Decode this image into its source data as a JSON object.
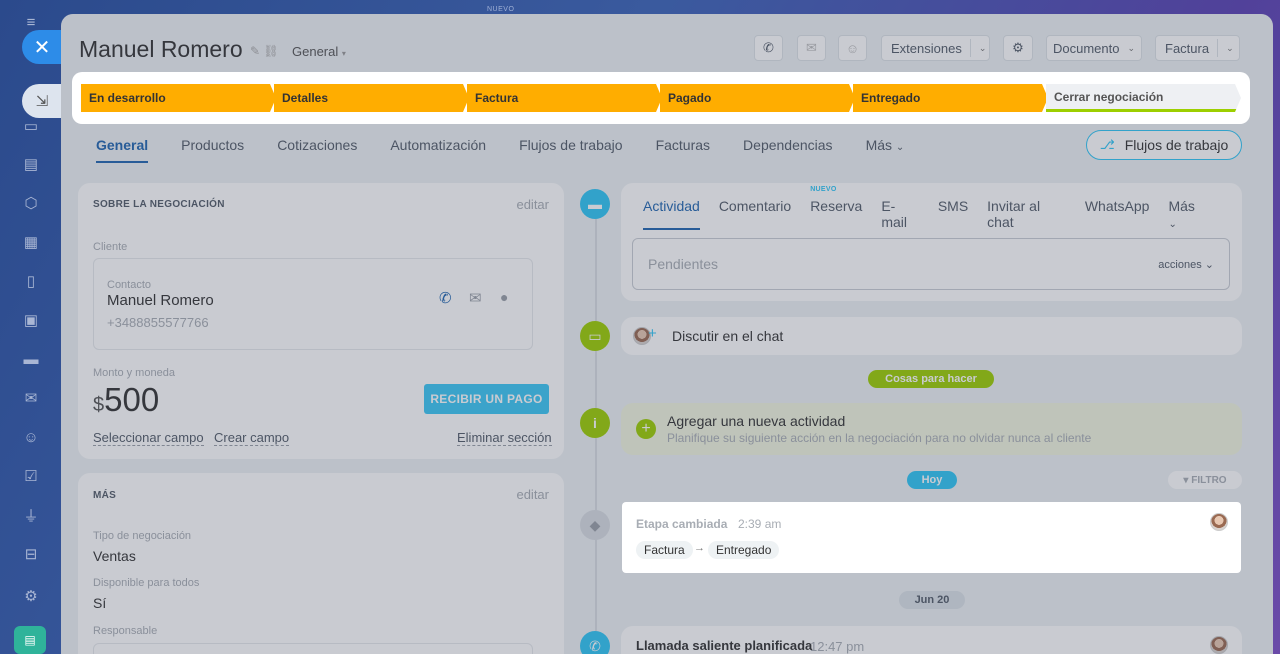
{
  "background": {
    "top_label": "NUEVO"
  },
  "leftbar": {
    "close_icon": "✕",
    "icons": [
      "chat-icon",
      "list-icon",
      "hexagon-icon",
      "calendar-icon",
      "document-icon",
      "board-icon",
      "card-icon",
      "mail-icon",
      "contacts-icon",
      "task-icon",
      "funnel-icon",
      "robot-icon",
      "settings-icon"
    ]
  },
  "header": {
    "title": "Manuel Romero",
    "category": "General",
    "extensions": "Extensiones",
    "document": "Documento",
    "invoice": "Factura"
  },
  "stages": [
    {
      "label": "En desarrollo",
      "color": "#ffad00"
    },
    {
      "label": "Detalles",
      "color": "#ffad00"
    },
    {
      "label": "Factura",
      "color": "#ffad00"
    },
    {
      "label": "Pagado",
      "color": "#ffad00"
    },
    {
      "label": "Entregado",
      "color": "#ffad00"
    },
    {
      "label": "Cerrar negociación",
      "color": "#eef0f3"
    }
  ],
  "tabs": [
    "General",
    "Productos",
    "Cotizaciones",
    "Automatización",
    "Flujos de trabajo",
    "Facturas",
    "Dependencias",
    "Más"
  ],
  "flows_button": "Flujos de trabajo",
  "deal_card": {
    "title": "SOBRE LA NEGOCIACIÓN",
    "edit": "editar",
    "client_label": "Cliente",
    "contact_label": "Contacto",
    "contact_name": "Manuel Romero",
    "contact_phone": "+3488855577766",
    "amount_label": "Monto y moneda",
    "currency": "$",
    "amount": "500",
    "pay_button": "RECIBIR UN PAGO",
    "select_field": "Seleccionar campo",
    "create_field": "Crear campo",
    "delete_section": "Eliminar sección"
  },
  "more_card": {
    "title": "MÁS",
    "edit": "editar",
    "type_label": "Tipo de negociación",
    "type_value": "Ventas",
    "available_label": "Disponible para todos",
    "available_value": "Sí",
    "responsible_label": "Responsable"
  },
  "activity": {
    "tabs": [
      "Actividad",
      "Comentario",
      "Reserva",
      "E-mail",
      "SMS",
      "Invitar al chat",
      "WhatsApp",
      "Más"
    ],
    "new_badge": "NUEVO",
    "pending_placeholder": "Pendientes",
    "actions": "acciones",
    "discuss": "Discutir en el chat",
    "todo_pill": "Cosas para hacer",
    "add_title": "Agregar una nueva actividad",
    "add_subtitle": "Planifique su siguiente acción en la negociación para no olvidar nunca al cliente",
    "today_pill": "Hoy",
    "filter": "FILTRO",
    "stage_changed": "Etapa cambiada",
    "stage_time": "2:39 am",
    "stage_from": "Factura",
    "stage_arrow": "→",
    "stage_to": "Entregado",
    "date_pill": "Jun 20",
    "call_title": "Llamada saliente planificada",
    "call_time": "12:47 pm"
  }
}
